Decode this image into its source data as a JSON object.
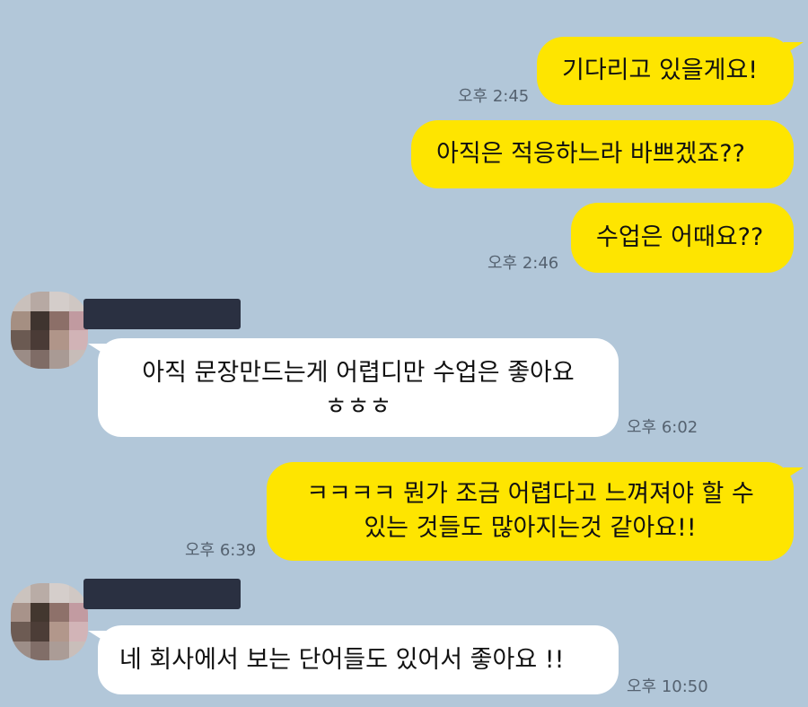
{
  "colors": {
    "background": "#b2c7d9",
    "my_bubble": "#fee500",
    "other_bubble": "#ffffff",
    "name_redaction": "#2a3041"
  },
  "messages": [
    {
      "text": "기다리고 있을게요!",
      "sender": "me"
    },
    {
      "text": "오후 2:45",
      "kind": "time"
    },
    {
      "text": "아직은 적응하느라 바쁘겠죠??",
      "sender": "me"
    },
    {
      "text": "수업은 어때요??",
      "sender": "me"
    },
    {
      "text": "오후 2:46",
      "kind": "time"
    },
    {
      "lines": [
        "아직 문장만드는게 어렵디만 수업은 좋아요",
        "ㅎㅎㅎ"
      ],
      "sender": "other"
    },
    {
      "text": "오후 6:02",
      "kind": "time"
    },
    {
      "lines": [
        "ㅋㅋㅋㅋ 뭔가 조금 어렵다고 느껴져야 할 수",
        "있는 것들도 많아지는것 같아요!!"
      ],
      "sender": "me"
    },
    {
      "text": "오후 6:39",
      "kind": "time"
    },
    {
      "text": "네 회사에서 보는 단어들도 있어서 좋아요 !!",
      "sender": "other"
    },
    {
      "text": "오후 10:50",
      "kind": "time"
    }
  ]
}
